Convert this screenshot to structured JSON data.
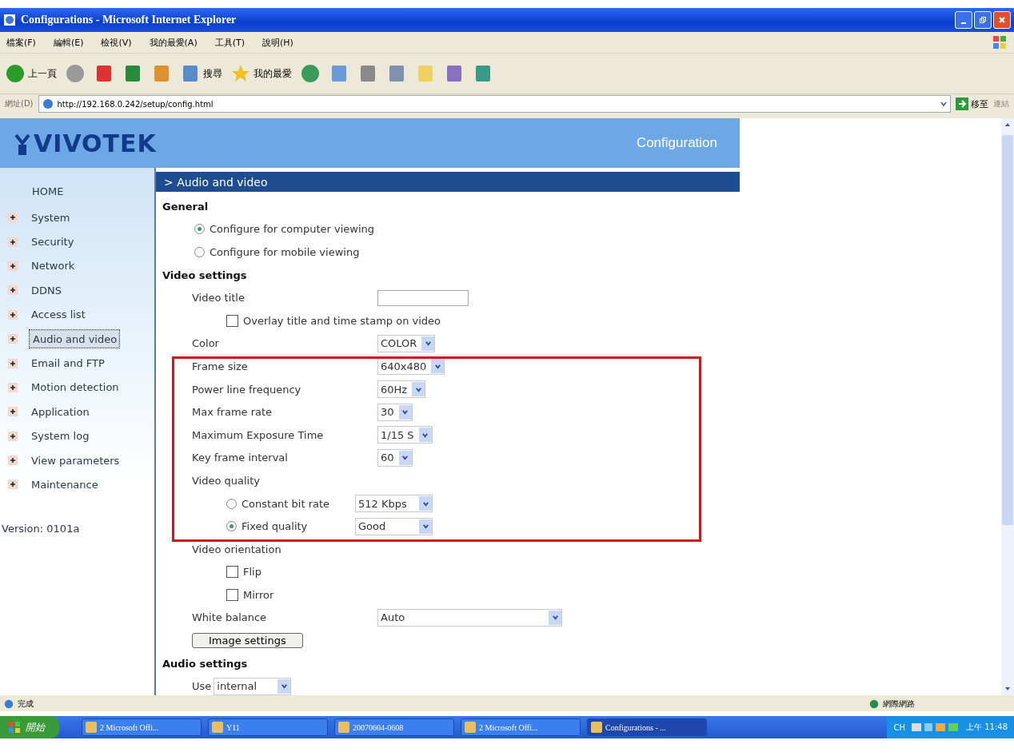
{
  "window": {
    "title": "Configurations - Microsoft Internet Explorer"
  },
  "menu": [
    "檔案(F)",
    "編輯(E)",
    "檢視(V)",
    "我的最愛(A)",
    "工具(T)",
    "說明(H)"
  ],
  "toolbar": [
    {
      "kind": "back",
      "label": "上一頁"
    },
    {
      "kind": "forward"
    },
    {
      "kind": "stop"
    },
    {
      "kind": "refresh"
    },
    {
      "kind": "home"
    },
    {
      "kind": "search",
      "label": "搜尋"
    },
    {
      "kind": "favorites",
      "label": "我的最愛"
    },
    {
      "kind": "history"
    },
    {
      "kind": "mail"
    },
    {
      "kind": "print"
    },
    {
      "kind": "edit"
    },
    {
      "kind": "folder"
    },
    {
      "kind": "research"
    },
    {
      "kind": "messenger"
    }
  ],
  "address": {
    "label": "網址(D)",
    "value": "http://192.168.0.242/setup/config.html",
    "go": "移至",
    "links": "連結"
  },
  "page": {
    "brand": "VIVOTEK",
    "header": "Configuration",
    "section": "> Audio and video",
    "sidebar": {
      "home": "HOME",
      "items": [
        {
          "label": "System",
          "selected": false
        },
        {
          "label": "Security",
          "selected": false
        },
        {
          "label": "Network",
          "selected": false
        },
        {
          "label": "DDNS",
          "selected": false
        },
        {
          "label": "Access list",
          "selected": false
        },
        {
          "label": "Audio and video",
          "selected": true
        },
        {
          "label": "Email and FTP",
          "selected": false
        },
        {
          "label": "Motion detection",
          "selected": false
        },
        {
          "label": "Application",
          "selected": false
        },
        {
          "label": "System log",
          "selected": false
        },
        {
          "label": "View parameters",
          "selected": false
        },
        {
          "label": "Maintenance",
          "selected": false
        }
      ],
      "version": "Version: 0101a"
    },
    "rows": [
      {
        "kind": "heading",
        "label": "General"
      },
      {
        "kind": "radio",
        "label": "Configure for computer viewing",
        "selected": true
      },
      {
        "kind": "radio",
        "label": "Configure for mobile viewing",
        "selected": false
      },
      {
        "kind": "heading",
        "label": "Video settings"
      },
      {
        "kind": "text_field",
        "label": "Video title"
      },
      {
        "kind": "checkbox",
        "label": "Overlay title and time stamp on video",
        "checked": false
      },
      {
        "kind": "select",
        "label": "Color",
        "value": "COLOR"
      },
      {
        "kind": "select",
        "label": "Frame size",
        "value": "640x480"
      },
      {
        "kind": "select",
        "label": "Power line frequency",
        "value": "60Hz"
      },
      {
        "kind": "select",
        "label": "Max frame rate",
        "value": "30"
      },
      {
        "kind": "select",
        "label": "Maximum Exposure Time",
        "value": "1/15 S"
      },
      {
        "kind": "select",
        "label": "Key frame interval",
        "value": "60"
      },
      {
        "kind": "label",
        "label": "Video quality"
      },
      {
        "kind": "radio_select",
        "label": "Constant bit rate",
        "selected": false,
        "value": "512 Kbps"
      },
      {
        "kind": "radio_select",
        "label": "Fixed quality",
        "selected": true,
        "value": "Good"
      },
      {
        "kind": "label",
        "label": "Video orientation"
      },
      {
        "kind": "checkbox",
        "label": "Flip",
        "checked": false
      },
      {
        "kind": "checkbox",
        "label": "Mirror",
        "checked": false
      },
      {
        "kind": "wide_select",
        "label": "White balance",
        "value": "Auto"
      },
      {
        "kind": "button",
        "label": "Image settings"
      },
      {
        "kind": "heading",
        "label": "Audio settings"
      },
      {
        "kind": "inline_select",
        "label": "Use",
        "value": "internal"
      }
    ]
  },
  "status_bar": {
    "text": "完成",
    "zone": "網際網路"
  },
  "taskbar": {
    "start": "開始",
    "tasks": [
      {
        "label": "2 Microsoft Offi...",
        "selected": false
      },
      {
        "label": "Y11",
        "selected": false
      },
      {
        "label": "20070604-0608",
        "selected": false
      },
      {
        "label": "2 Microsoft Offi...",
        "selected": false
      },
      {
        "label": "Configurations - ...",
        "selected": true
      }
    ],
    "lang": "CH",
    "clock": "上午 11:48"
  }
}
